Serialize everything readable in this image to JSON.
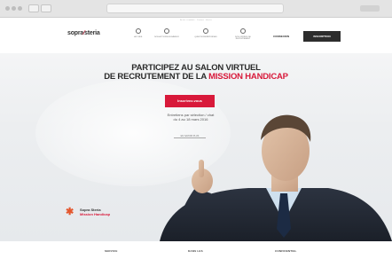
{
  "browser": {
    "address": "",
    "colors": {
      "chrome": "#e4e4e4"
    }
  },
  "header": {
    "top_links": "Accès candidat · Contact · Accès",
    "logo": {
      "part1": "sopra",
      "slash": "⁄",
      "part2": "steria"
    },
    "nav": [
      {
        "icon": "home-icon",
        "label": "ACCUEIL"
      },
      {
        "icon": "hand-icon",
        "label": "NOS ACTIONS EN FAVEUR"
      },
      {
        "icon": "info-icon",
        "label": "QUESTIONS/RÉPONSES"
      },
      {
        "icon": "chat-icon",
        "label": "NOS OFFRES DE RECRUTEMENT"
      }
    ],
    "connexion_label": "CONNEXION",
    "inscription_label": "INSCRIPTION"
  },
  "hero": {
    "headline_line1": "PARTICIPEZ AU SALON VIRTUEL",
    "headline_line2_plain": "DE RECRUTEMENT DE LA",
    "headline_line2_accent": "MISSION HANDICAP",
    "cta_label": "Inscrivez-vous",
    "event_line1": "Entretiens par sélection / chat",
    "event_line2": "du 4 au 18 mars 2016",
    "more_link": "EN SAVOIR PLUS",
    "brand": {
      "line1": "Sopra Steria",
      "line2": "Mission Handicap"
    },
    "colors": {
      "accent": "#d8193a",
      "brand_orange": "#e4572e"
    }
  },
  "footer": {
    "items": [
      "SERVICE",
      "DANS LES",
      "CONFIDENTIEL"
    ]
  }
}
